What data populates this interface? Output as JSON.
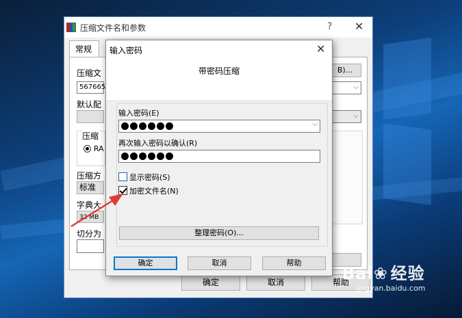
{
  "background_window": {
    "title": "压缩文件名和参数",
    "help_glyph": "?",
    "close_glyph": "✕",
    "tabs": [
      "常规"
    ],
    "filename_label": "压缩文",
    "filename_value": "567665",
    "browse_button": "B)...",
    "profile_label": "默认配",
    "format_group_label": "压缩",
    "format_radio_label": "RA",
    "method_label": "压缩方",
    "method_value": "标准",
    "dict_label": "字典大",
    "dict_value": "32 MB",
    "split_label": "切分为",
    "ok_button": "确定",
    "cancel_button": "取消",
    "help_button": "帮助"
  },
  "password_dialog": {
    "title": "输入密码",
    "close_glyph": "✕",
    "header": "带密码压缩",
    "enter_password_label": "输入密码(E)",
    "password_dot_count": 6,
    "confirm_password_label": "再次输入密码以确认(R)",
    "confirm_dot_count": 6,
    "show_password_label": "显示密码(S)",
    "show_password_checked": false,
    "encrypt_filenames_label": "加密文件名(N)",
    "encrypt_filenames_checked": true,
    "organize_button": "整理密码(O)...",
    "ok_button": "确定",
    "cancel_button": "取消",
    "help_button": "帮助"
  },
  "watermark": {
    "brand": "Bai",
    "brand_cn": "经验",
    "url": "jingyan.baidu.com"
  },
  "colors": {
    "accent": "#0078d7",
    "arrow": "#e03a3a"
  }
}
